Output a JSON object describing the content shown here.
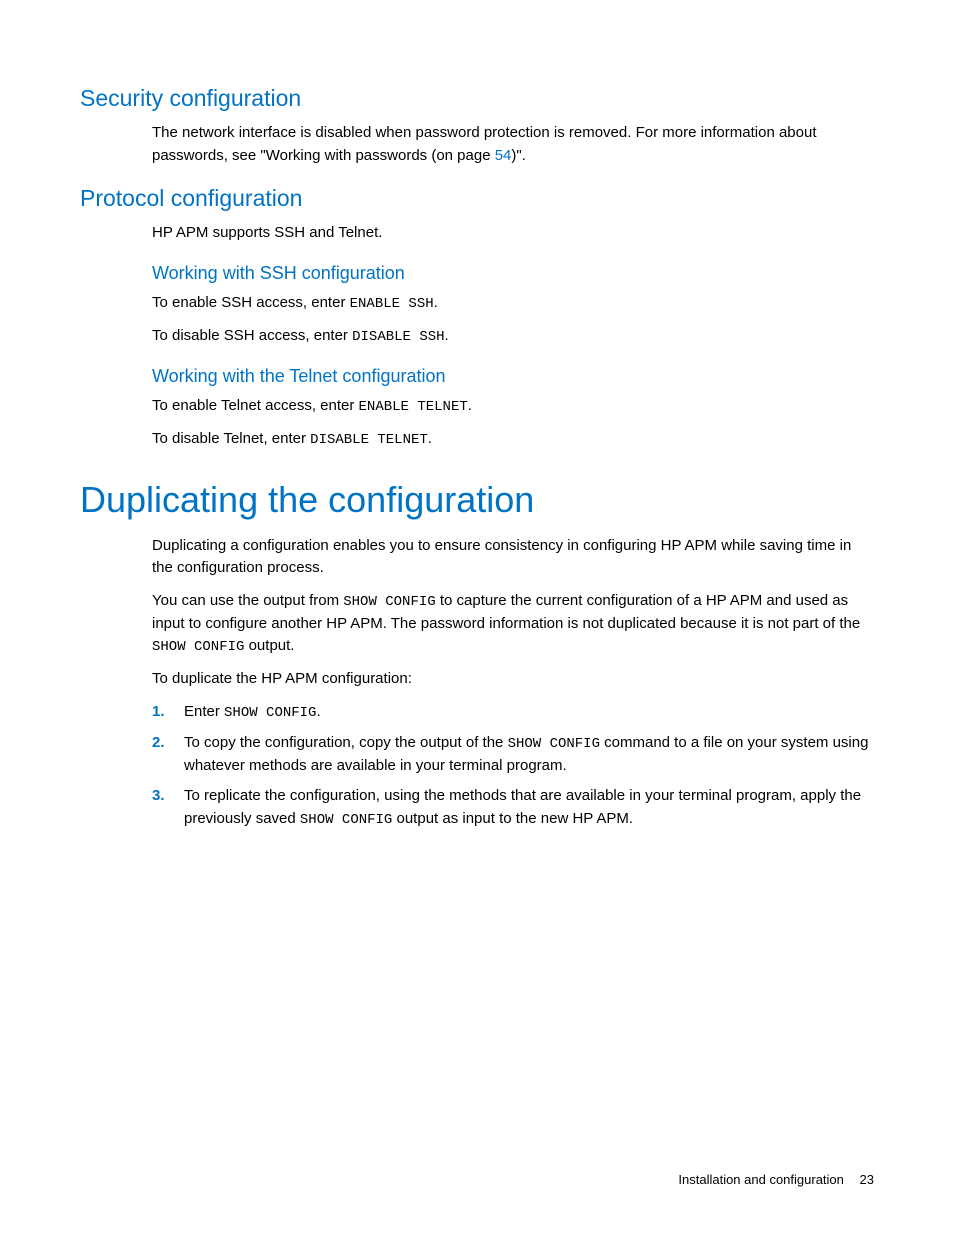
{
  "sections": {
    "security": {
      "heading": "Security configuration",
      "p1a": "The network interface is disabled when password protection is removed. For more information about passwords, see \"Working with passwords (on page ",
      "p1_link": "54",
      "p1b": ")\"."
    },
    "protocol": {
      "heading": "Protocol configuration",
      "p1": "HP APM supports SSH and Telnet.",
      "ssh": {
        "heading": "Working with SSH configuration",
        "enable_a": "To enable SSH access, enter ",
        "enable_cmd": "ENABLE SSH",
        "disable_a": "To disable SSH access, enter ",
        "disable_cmd": "DISABLE SSH"
      },
      "telnet": {
        "heading": "Working with the Telnet configuration",
        "enable_a": "To enable Telnet access, enter ",
        "enable_cmd": "ENABLE TELNET",
        "disable_a": "To disable Telnet, enter ",
        "disable_cmd": "DISABLE TELNET"
      }
    },
    "duplicating": {
      "heading": "Duplicating the configuration",
      "p1": "Duplicating a configuration enables you to ensure consistency in configuring HP APM while saving time in the configuration process.",
      "p2a": "You can use the output from ",
      "p2_cmd1": "SHOW CONFIG",
      "p2b": " to capture the current configuration of a HP APM and used as input to configure another HP APM. The password information is not duplicated because it is not part of the ",
      "p2_cmd2": "SHOW CONFIG",
      "p2c": " output.",
      "p3": "To duplicate the HP APM configuration:",
      "steps": {
        "s1a": "Enter ",
        "s1_cmd": "SHOW CONFIG",
        "s1b": ".",
        "s2a": "To copy the configuration, copy the output of the ",
        "s2_cmd": "SHOW CONFIG",
        "s2b": " command to a file on your system using whatever methods are available in your terminal program.",
        "s3a": "To replicate the configuration, using the methods that are available in your terminal program, apply the previously saved ",
        "s3_cmd": "SHOW CONFIG",
        "s3b": " output as input to the new HP APM."
      }
    }
  },
  "footer": {
    "section": "Installation and configuration",
    "page": "23"
  }
}
